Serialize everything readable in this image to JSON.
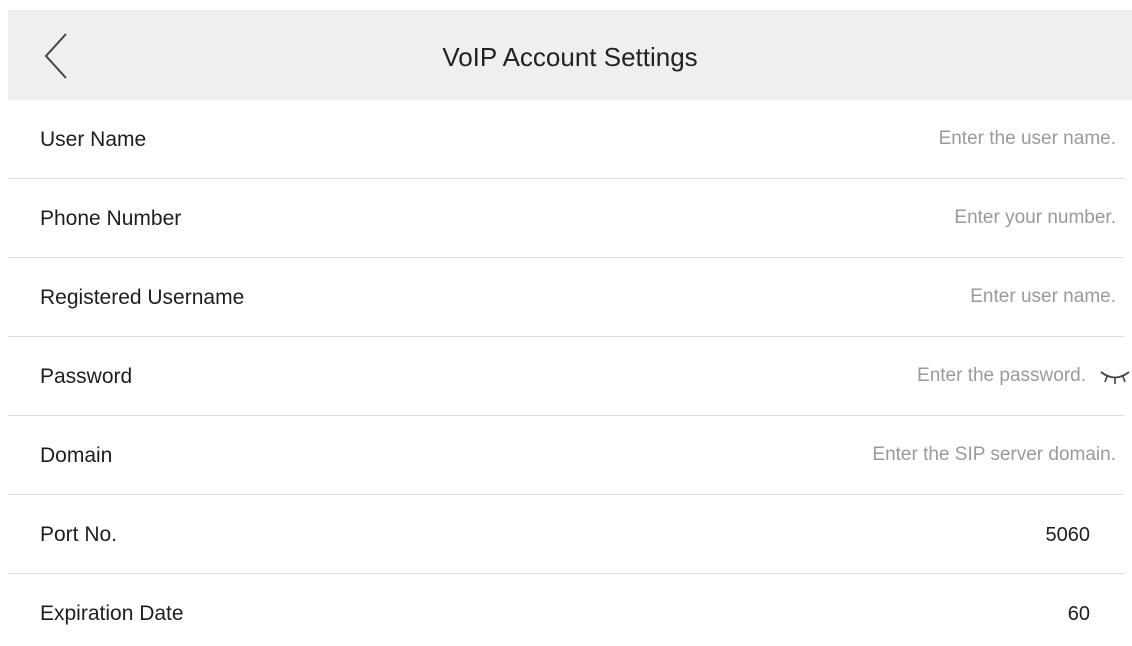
{
  "header": {
    "title": "VoIP Account Settings",
    "back_icon": "chevron-left-icon"
  },
  "fields": {
    "user_name": {
      "label": "User Name",
      "placeholder": "Enter the user name."
    },
    "phone_number": {
      "label": "Phone Number",
      "placeholder": "Enter your number."
    },
    "registered_username": {
      "label": "Registered Username",
      "placeholder": "Enter user name."
    },
    "password": {
      "label": "Password",
      "placeholder": "Enter the password.",
      "toggle_icon": "eye-closed-icon"
    },
    "domain": {
      "label": "Domain",
      "placeholder": "Enter the SIP server domain."
    },
    "port": {
      "label": "Port No.",
      "value": "5060"
    },
    "expiration": {
      "label": "Expiration Date",
      "value": "60"
    }
  },
  "colors": {
    "header_bg": "#efefef",
    "divider": "#dcdcdc",
    "text": "#1e1e1e",
    "placeholder": "#9a9a9a"
  }
}
